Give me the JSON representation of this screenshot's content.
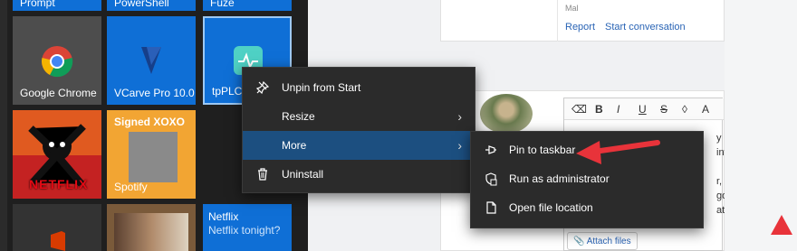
{
  "start_menu": {
    "top_row": [
      "Prompt",
      "PowerShell",
      "Fuze"
    ],
    "tiles": {
      "chrome": "Google Chrome",
      "vcarve": "VCarve Pro 10.0",
      "tpplc": "tpPLC",
      "spotify_title": "Signed XOXO",
      "spotify": "Spotify",
      "netflix_logo": "NETFLIX",
      "netflix_live_title": "Netflix",
      "netflix_live_sub": "Netflix tonight?"
    }
  },
  "context_menu": {
    "items": [
      {
        "label": "Unpin from Start",
        "icon": "unpin-icon",
        "has_submenu": false
      },
      {
        "label": "Resize",
        "icon": "",
        "has_submenu": true
      },
      {
        "label": "More",
        "icon": "",
        "has_submenu": true,
        "highlighted": true
      },
      {
        "label": "Uninstall",
        "icon": "trash-icon",
        "has_submenu": false
      }
    ]
  },
  "submenu": {
    "items": [
      {
        "label": "Pin to taskbar",
        "icon": "pin-icon"
      },
      {
        "label": "Run as administrator",
        "icon": "shield-icon"
      },
      {
        "label": "Open file location",
        "icon": "file-icon"
      }
    ]
  },
  "browser": {
    "author_fragment": "Mal",
    "report_link": "Report",
    "start_conversation_link": "Start conversation",
    "editor_toolbar": [
      "⌫",
      "B",
      "I",
      "U",
      "S",
      "◊",
      "A"
    ],
    "editor_text_fragments": [
      "y ea",
      "inte",
      "r, I *",
      "go i",
      "at o"
    ],
    "attach_label": "Attach files"
  },
  "colors": {
    "accent_blue": "#0f6fd6",
    "menu_bg": "#2b2b2b",
    "menu_highlight": "#1c4f80",
    "annotation_red": "#e8333a"
  }
}
